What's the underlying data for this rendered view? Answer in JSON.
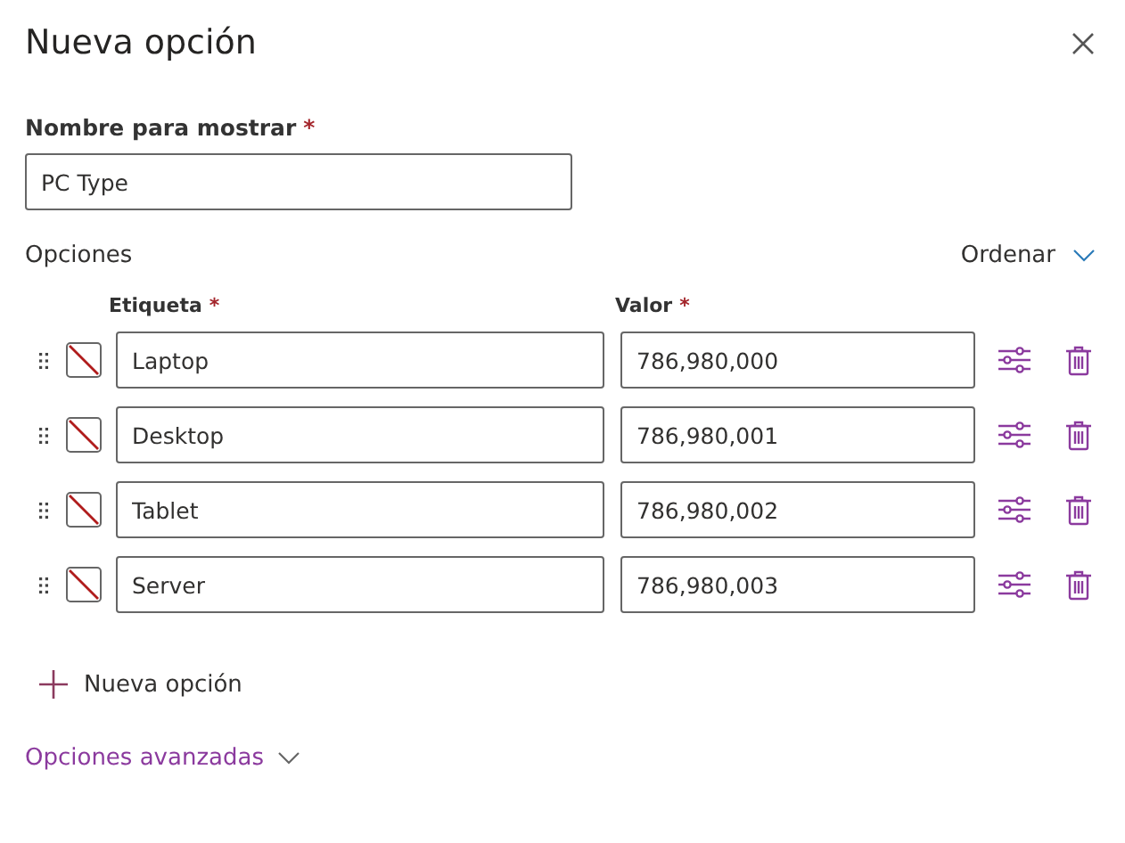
{
  "panel": {
    "title": "Nueva opción"
  },
  "display_name": {
    "label": "Nombre para mostrar",
    "required_mark": "*",
    "value": "PC Type"
  },
  "options": {
    "heading": "Opciones",
    "sort_button": "Ordenar",
    "columns": [
      {
        "label": "Etiqueta",
        "required_mark": "*"
      },
      {
        "label": "Valor",
        "required_mark": "*"
      }
    ],
    "rows": [
      {
        "label": "Laptop",
        "value": "786,980,000"
      },
      {
        "label": "Desktop",
        "value": "786,980,001"
      },
      {
        "label": "Tablet",
        "value": "786,980,002"
      },
      {
        "label": "Server",
        "value": "786,980,003"
      }
    ],
    "add_button": "Nueva opción"
  },
  "advanced_link": "Opciones avanzadas"
}
